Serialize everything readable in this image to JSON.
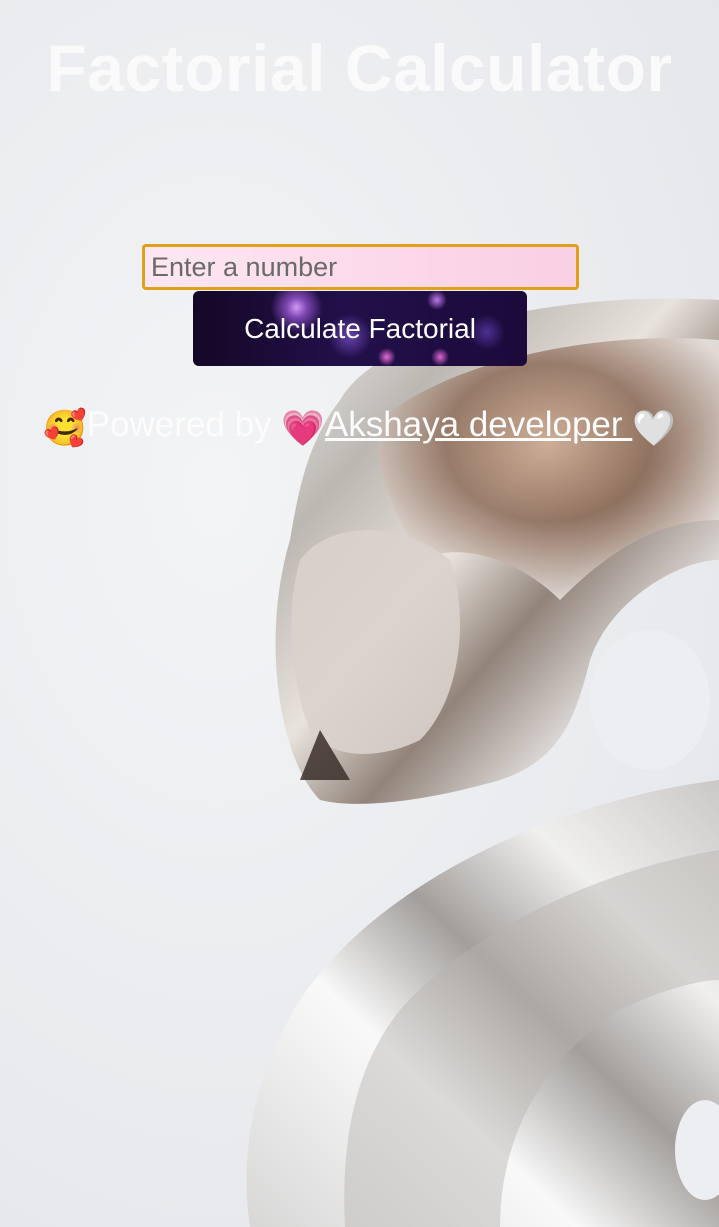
{
  "page": {
    "title": "Factorial Calculator"
  },
  "form": {
    "input_placeholder": "Enter a number",
    "input_value": "",
    "button_label": "Calculate Factorial"
  },
  "footer": {
    "prefix": "Powered by ",
    "link_text": "Akshaya developer "
  },
  "colors": {
    "input_border": "#e0a11a",
    "input_background": "#fcd9ea",
    "button_background": "#1b0a3a",
    "text_white": "#fcfcfc"
  },
  "icons": [
    "smiling-face-with-hearts-icon",
    "growing-heart-icon",
    "white-heart-icon"
  ]
}
